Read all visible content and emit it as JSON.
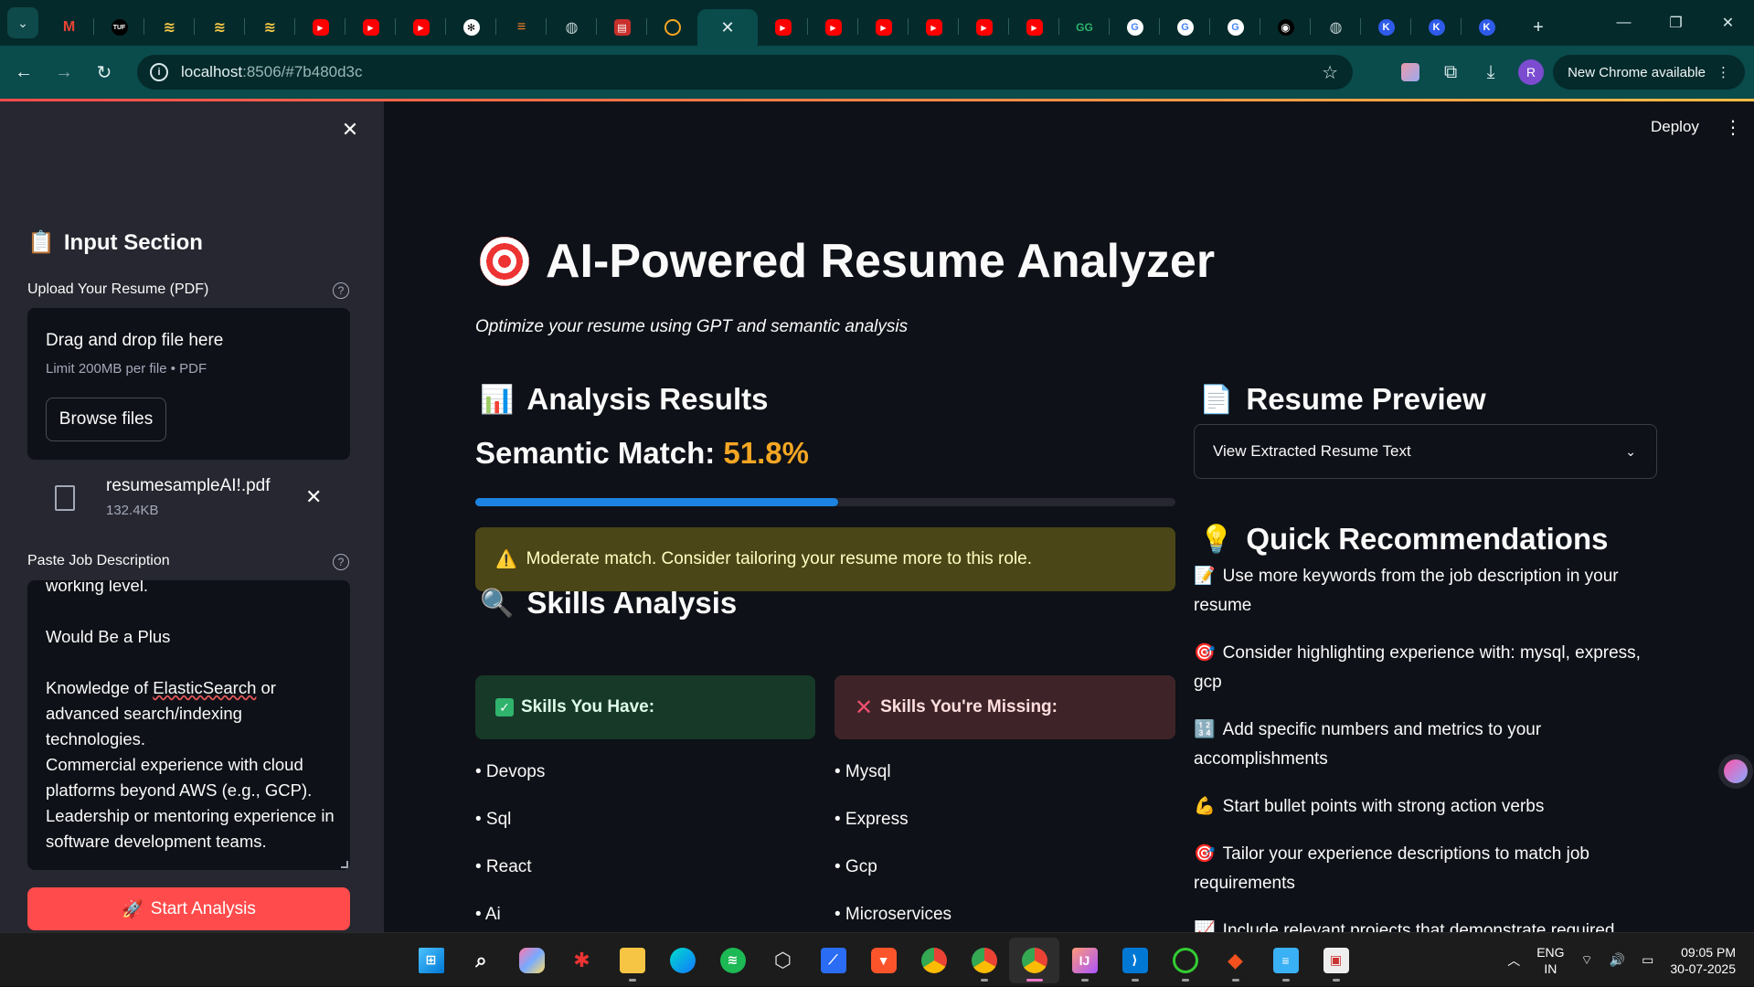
{
  "browser": {
    "address_host": "localhost",
    "address_path": ":8506/#7b480d3c",
    "chrome_update_label": "New Chrome available",
    "profile_initial": "R",
    "tab_favicons": [
      "gmail-icon",
      "tuf-icon",
      "stack-icon",
      "stack-icon",
      "stack-icon",
      "youtube-icon",
      "youtube-icon",
      "youtube-icon",
      "openai-icon",
      "stackoverflow-icon",
      "globe-icon",
      "pdf-icon",
      "loading-icon",
      "active-tab",
      "youtube-icon",
      "youtube-icon",
      "youtube-icon",
      "youtube-icon",
      "youtube-icon",
      "youtube-icon",
      "gfg-icon",
      "google-icon",
      "google-icon",
      "google-icon",
      "github-icon",
      "globe-icon",
      "k-icon",
      "k-icon",
      "k-icon"
    ]
  },
  "sidebar": {
    "section_title": "Input Section",
    "section_emoji": "📋",
    "upload_label": "Upload Your Resume (PDF)",
    "dropzone_title": "Drag and drop file here",
    "dropzone_limit": "Limit 200MB per file • PDF",
    "browse_label": "Browse files",
    "file_name": "resumesampleAI!.pdf",
    "file_size": "132.4KB",
    "jd_label": "Paste Job Description",
    "jd_text_line0": "working level.",
    "jd_text_plus": "Would Be a Plus",
    "jd_text_pre": "Knowledge of ",
    "jd_text_spell": "ElasticSearch",
    "jd_text_post": " or advanced search/indexing technologies.\nCommercial experience with cloud platforms beyond AWS (e.g., GCP).\nLeadership or mentoring experience in software development teams.",
    "start_label": "Start Analysis",
    "start_emoji": "🚀"
  },
  "main": {
    "deploy_label": "Deploy",
    "title": "AI-Powered Resume Analyzer",
    "subtitle": "Optimize your resume using GPT and semantic analysis",
    "analysis_heading": "Analysis Results",
    "analysis_emoji": "📊",
    "semantic_label": "Semantic Match:",
    "semantic_value": "51.8%",
    "semantic_fraction": 0.518,
    "warning_text": "Moderate match. Consider tailoring your resume more to this role.",
    "warning_emoji": "⚠️",
    "skills_heading": "Skills Analysis",
    "skills_emoji": "🔍",
    "have_label": "Skills You Have:",
    "missing_label": "Skills You're Missing:",
    "skills_have": [
      "• Devops",
      "• Sql",
      "• React",
      "• Ai"
    ],
    "skills_missing": [
      "• Mysql",
      "• Express",
      "• Gcp",
      "• Microservices"
    ],
    "preview_heading": "Resume Preview",
    "preview_emoji": "📄",
    "expander_label": "View Extracted Resume Text",
    "recs_heading": "Quick Recommendations",
    "recs_emoji": "💡",
    "recommendations": [
      {
        "emoji": "📝",
        "text": "Use more keywords from the job description in your resume"
      },
      {
        "emoji": "🎯",
        "text": "Consider highlighting experience with: mysql, express, gcp"
      },
      {
        "emoji": "🔢",
        "text": "Add specific numbers and metrics to your accomplishments"
      },
      {
        "emoji": "💪",
        "text": "Start bullet points with strong action verbs"
      },
      {
        "emoji": "🎯",
        "text": "Tailor your experience descriptions to match job requirements"
      },
      {
        "emoji": "📈",
        "text": "Include relevant projects that demonstrate required"
      }
    ]
  },
  "taskbar": {
    "lang_top": "ENG",
    "lang_bottom": "IN",
    "time": "09:05 PM",
    "date": "30-07-2025",
    "colors": {
      "accent": "#ff4b4b",
      "progress": "#1c83e1",
      "match_value": "#f5a623"
    }
  }
}
